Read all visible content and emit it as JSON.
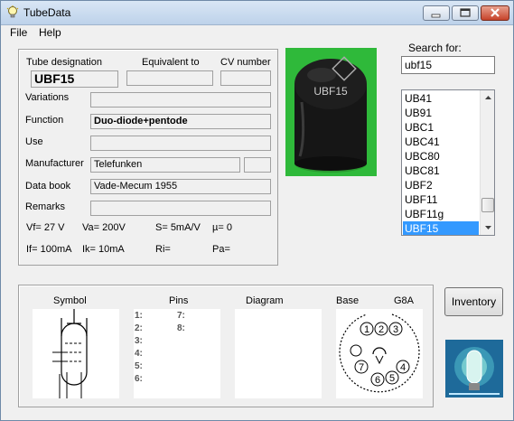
{
  "window": {
    "title": "TubeData"
  },
  "menu": [
    "File",
    "Help"
  ],
  "tube": {
    "label_designation": "Tube designation",
    "label_equivalent": "Equivalent to",
    "label_cv": "CV number",
    "designation": "UBF15",
    "equivalent": "",
    "cv_number": "",
    "label_variations": "Variations",
    "variations": "",
    "label_function": "Function",
    "function": "Duo-diode+pentode",
    "label_use": "Use",
    "use": "",
    "label_manufacturer": "Manufacturer",
    "manufacturer": "Telefunken",
    "manufacturer_extra": "",
    "label_databook": "Data book",
    "databook": "Vade-Mecum 1955",
    "label_remarks": "Remarks",
    "remarks": ""
  },
  "params": {
    "vf": "Vf= 27 V",
    "va": "Va=  200V",
    "s": "S= 5mA/V",
    "mu": "µ=    0",
    "if": "If= 100mA",
    "ik": "Ik=  10mA",
    "ri": "Ri=",
    "pa": "Pa="
  },
  "search": {
    "label": "Search for:",
    "value": "ubf15"
  },
  "list": {
    "items": [
      "UB41",
      "UB91",
      "UBC1",
      "UBC41",
      "UBC80",
      "UBC81",
      "UBF2",
      "UBF11",
      "UBF11g",
      "UBF15"
    ],
    "selected": "UBF15"
  },
  "bottom": {
    "symbol_label": "Symbol",
    "pins_label": "Pins",
    "diagram_label": "Diagram",
    "base_label": "Base",
    "base_type": "G8A",
    "pins": [
      "1:",
      "2:",
      "3:",
      "4:",
      "5:",
      "6:",
      "7:",
      "8:"
    ]
  },
  "photo": {
    "marking": "UBF15"
  },
  "buttons": {
    "inventory": "Inventory"
  }
}
